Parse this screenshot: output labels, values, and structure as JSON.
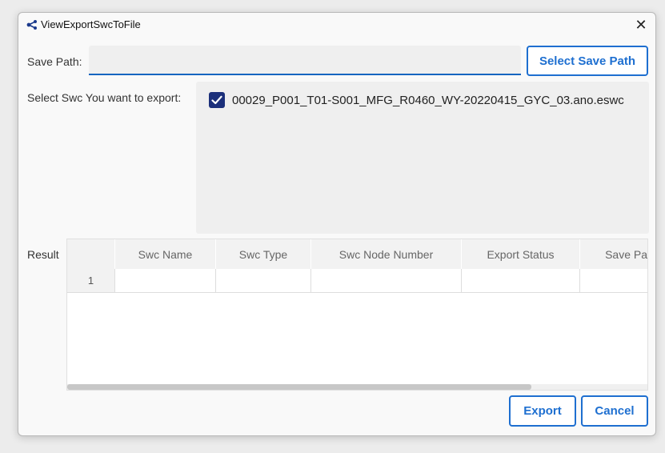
{
  "window": {
    "title": "ViewExportSwcToFile",
    "close_glyph": "✕"
  },
  "save_path": {
    "label": "Save Path:",
    "value": "",
    "placeholder": "",
    "select_button": "Select Save Path"
  },
  "swc_select": {
    "label": "Select Swc You want to export:",
    "items": [
      {
        "name": "00029_P001_T01-S001_MFG_R0460_WY-20220415_GYC_03.ano.eswc",
        "checked": true
      }
    ]
  },
  "result": {
    "label": "Result",
    "columns": [
      "Swc Name",
      "Swc Type",
      "Swc Node Number",
      "Export Status",
      "Save Pat"
    ],
    "rows": [
      {
        "index": "1",
        "cells": [
          "",
          "",
          "",
          "",
          ""
        ]
      }
    ]
  },
  "actions": {
    "export": "Export",
    "cancel": "Cancel"
  },
  "colors": {
    "accent": "#1e6fd0",
    "checkbox": "#1b2f7a",
    "input_underline": "#1565c0"
  },
  "icons": {
    "app": "share-nodes-icon",
    "close": "close-icon",
    "check": "checkmark-icon"
  }
}
